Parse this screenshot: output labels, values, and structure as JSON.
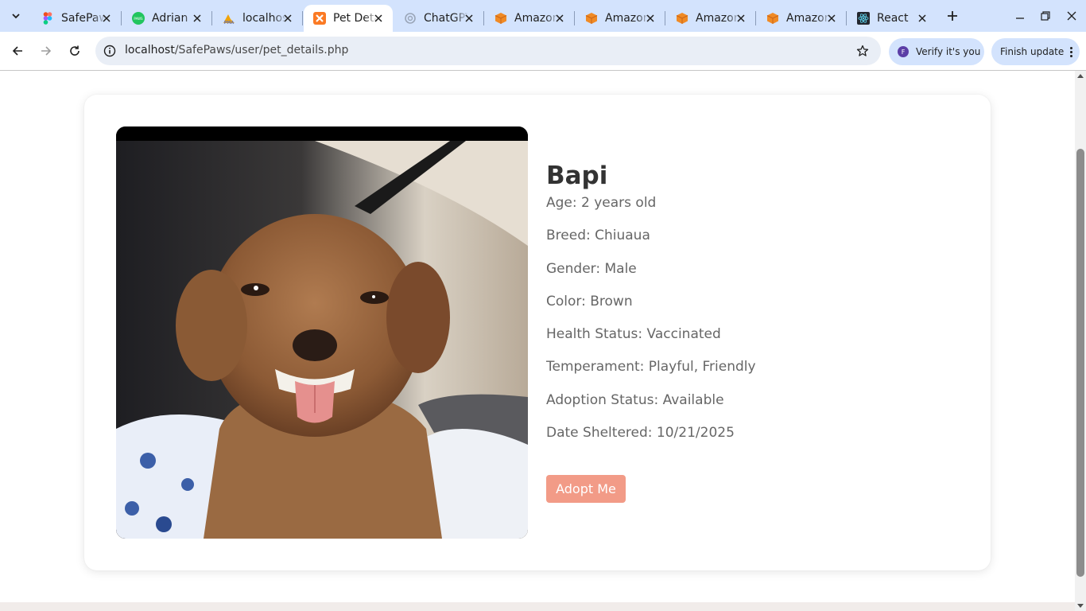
{
  "browser": {
    "tabs": [
      {
        "title": "SafePaws",
        "icon": "figma-icon"
      },
      {
        "title": "Adrian",
        "icon": "paws-icon"
      },
      {
        "title": "localhost",
        "icon": "phpmyadmin-icon"
      },
      {
        "title": "Pet Details",
        "icon": "xampp-icon",
        "active": true
      },
      {
        "title": "ChatGPT",
        "icon": "chatgpt-icon"
      },
      {
        "title": "Amazon",
        "icon": "amazon-box-icon"
      },
      {
        "title": "Amazon",
        "icon": "amazon-box-icon"
      },
      {
        "title": "Amazon",
        "icon": "amazon-box-icon"
      },
      {
        "title": "Amazon",
        "icon": "amazon-box-icon"
      },
      {
        "title": "React",
        "icon": "react-icon"
      }
    ],
    "address": {
      "host": "localhost",
      "path": "/SafePaws/user/pet_details.php"
    },
    "verify_label": "Verify it's you",
    "verify_avatar": "F",
    "finish_update_label": "Finish update",
    "accent": "#d3e3fd"
  },
  "pet": {
    "name": "Bapi",
    "attributes": [
      {
        "label": "Age:",
        "value": "2 years old"
      },
      {
        "label": "Breed:",
        "value": "Chiuaua"
      },
      {
        "label": "Gender:",
        "value": "Male"
      },
      {
        "label": "Color:",
        "value": "Brown"
      },
      {
        "label": "Health Status:",
        "value": "Vaccinated"
      },
      {
        "label": "Temperament:",
        "value": "Playful, Friendly"
      },
      {
        "label": "Adoption Status:",
        "value": "Available"
      },
      {
        "label": "Date Sheltered:",
        "value": "10/21/2025"
      }
    ],
    "adopt_label": "Adopt Me",
    "button_color": "#f29b87",
    "photo_icon": "dog-photo"
  }
}
